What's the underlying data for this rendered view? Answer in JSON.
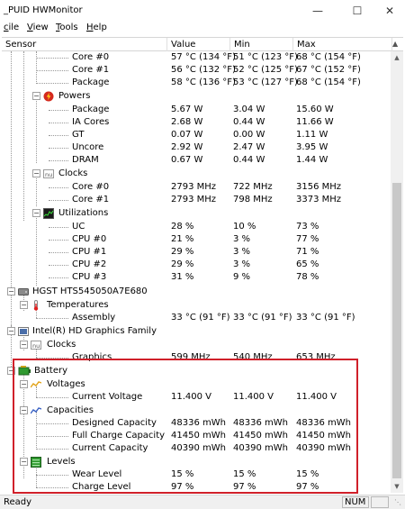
{
  "window": {
    "title": "_PUID HWMonitor"
  },
  "menu": [
    {
      "pre": "",
      "u": "c",
      "post": "ile"
    },
    {
      "pre": "",
      "u": "V",
      "post": "iew"
    },
    {
      "pre": "",
      "u": "T",
      "post": "ools"
    },
    {
      "pre": "",
      "u": "H",
      "post": "elp"
    }
  ],
  "columns": {
    "sensor": "Sensor",
    "value": "Value",
    "min": "Min",
    "max": "Max"
  },
  "rows": [
    {
      "label": "Core #0",
      "value": "57 °C  (134 °F)",
      "min": "51 °C  (123 °F)",
      "max": "68 °C  (154 °F)"
    },
    {
      "label": "Core #1",
      "value": "56 °C  (132 °F)",
      "min": "52 °C  (125 °F)",
      "max": "67 °C  (152 °F)"
    },
    {
      "label": "Package",
      "value": "58 °C  (136 °F)",
      "min": "53 °C  (127 °F)",
      "max": "68 °C  (154 °F)"
    },
    {
      "label": "Powers"
    },
    {
      "label": "Package",
      "value": "5.67 W",
      "min": "3.04 W",
      "max": "15.60 W"
    },
    {
      "label": "IA Cores",
      "value": "2.68 W",
      "min": "0.44 W",
      "max": "11.66 W"
    },
    {
      "label": "GT",
      "value": "0.07 W",
      "min": "0.00 W",
      "max": "1.11 W"
    },
    {
      "label": "Uncore",
      "value": "2.92 W",
      "min": "2.47 W",
      "max": "3.95 W"
    },
    {
      "label": "DRAM",
      "value": "0.67 W",
      "min": "0.44 W",
      "max": "1.44 W"
    },
    {
      "label": "Clocks"
    },
    {
      "label": "Core #0",
      "value": "2793 MHz",
      "min": "722 MHz",
      "max": "3156 MHz"
    },
    {
      "label": "Core #1",
      "value": "2793 MHz",
      "min": "798 MHz",
      "max": "3373 MHz"
    },
    {
      "label": "Utilizations"
    },
    {
      "label": "UC",
      "value": "28 %",
      "min": "10 %",
      "max": "73 %"
    },
    {
      "label": "CPU #0",
      "value": "21 %",
      "min": "3 %",
      "max": "77 %"
    },
    {
      "label": "CPU #1",
      "value": "29 %",
      "min": "3 %",
      "max": "71 %"
    },
    {
      "label": "CPU #2",
      "value": "29 %",
      "min": "3 %",
      "max": "65 %"
    },
    {
      "label": "CPU #3",
      "value": "31 %",
      "min": "9 %",
      "max": "78 %"
    },
    {
      "label": "HGST HTS545050A7E680"
    },
    {
      "label": "Temperatures"
    },
    {
      "label": "Assembly",
      "value": "33 °C  (91 °F)",
      "min": "33 °C  (91 °F)",
      "max": "33 °C  (91 °F)"
    },
    {
      "label": "Intel(R) HD Graphics Family"
    },
    {
      "label": "Clocks"
    },
    {
      "label": "Graphics",
      "value": "599 MHz",
      "min": "540 MHz",
      "max": "653 MHz"
    },
    {
      "label": "Battery"
    },
    {
      "label": "Voltages"
    },
    {
      "label": "Current Voltage",
      "value": "11.400 V",
      "min": "11.400 V",
      "max": "11.400 V"
    },
    {
      "label": "Capacities"
    },
    {
      "label": "Designed Capacity",
      "value": "48336 mWh",
      "min": "48336 mWh",
      "max": "48336 mWh"
    },
    {
      "label": "Full Charge Capacity",
      "value": "41450 mWh",
      "min": "41450 mWh",
      "max": "41450 mWh"
    },
    {
      "label": "Current Capacity",
      "value": "40390 mWh",
      "min": "40390 mWh",
      "max": "40390 mWh"
    },
    {
      "label": "Levels"
    },
    {
      "label": "Wear Level",
      "value": "15 %",
      "min": "15 %",
      "max": "15 %"
    },
    {
      "label": "Charge Level",
      "value": "97 %",
      "min": "97 %",
      "max": "97 %"
    }
  ],
  "status": {
    "text": "Ready",
    "num": "NUM"
  },
  "accent": {
    "highlight": "#d0202a"
  }
}
